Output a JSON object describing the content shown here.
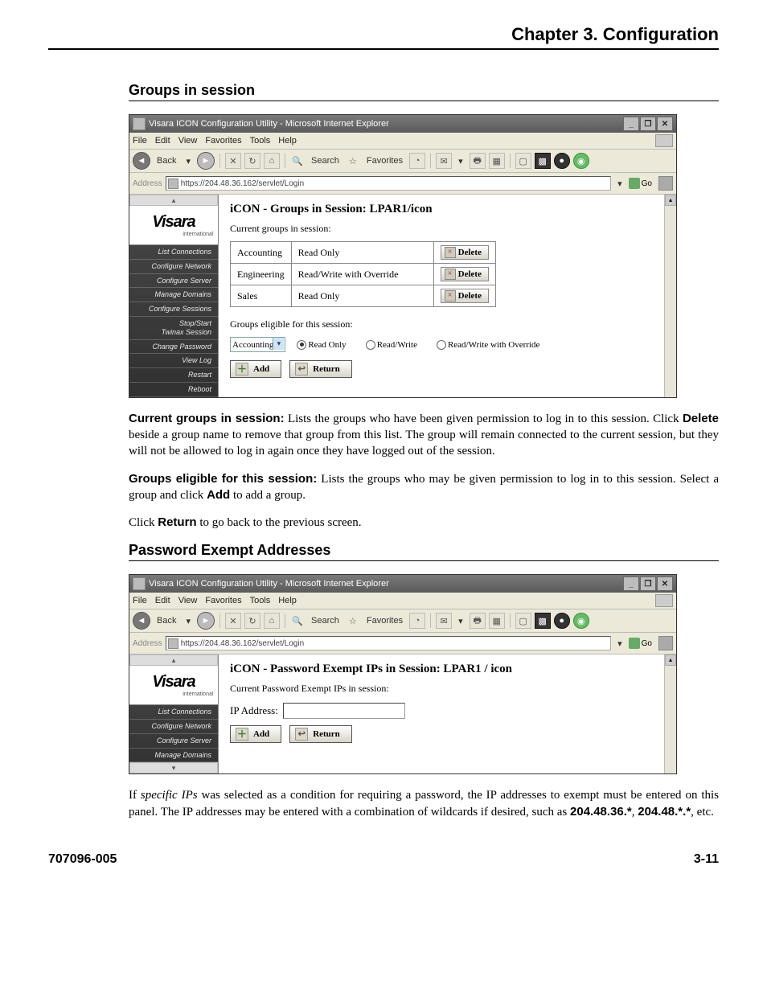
{
  "chapter_title": "Chapter 3.  Configuration",
  "section1": {
    "heading": "Groups in session",
    "para1": {
      "lead": "Current groups in session:",
      "body_a": " Lists the groups who have been given permission to log in to this session. Click ",
      "bold_delete": "Delete",
      "body_b": " beside a group name to remove that group from this list. The group will remain connected to the current session, but they will not be allowed to log in again once they have logged out of the session."
    },
    "para2": {
      "lead": "Groups eligible for this session:",
      "body_a": "  Lists the groups who may be given permission to log in to this session. Select a group and click ",
      "bold_add": "Add",
      "body_b": " to add a group."
    },
    "para3": {
      "prefix": "Click ",
      "bold_return": "Return",
      "suffix": " to go back to the previous screen."
    }
  },
  "screenshot1": {
    "title": "Visara ICON Configuration Utility - Microsoft Internet Explorer",
    "menubar": [
      "File",
      "Edit",
      "View",
      "Favorites",
      "Tools",
      "Help"
    ],
    "toolbar": {
      "back": "Back",
      "search": "Search",
      "favorites": "Favorites"
    },
    "address_label": "Address",
    "address_value": "https://204.48.36.162/servlet/Login",
    "go_label": "Go",
    "logo_main": "Visara",
    "logo_sub": "international",
    "nav_items": [
      "List Connections",
      "Configure Network",
      "Configure Server",
      "Manage Domains",
      "Configure Sessions",
      "Stop/Start\nTwinax Session",
      "Change Password",
      "View Log",
      "Restart",
      "Reboot"
    ],
    "content_title": "iCON - Groups in Session: LPAR1/icon",
    "current_groups_label": "Current groups in session:",
    "groups_table": [
      {
        "name": "Accounting",
        "mode": "Read Only"
      },
      {
        "name": "Engineering",
        "mode": "Read/Write with Override"
      },
      {
        "name": "Sales",
        "mode": "Read Only"
      }
    ],
    "delete_label": "Delete",
    "eligible_label": "Groups eligible for this session:",
    "eligible_select_value": "Accounting",
    "radio_options": [
      "Read Only",
      "Read/Write",
      "Read/Write with Override"
    ],
    "add_label": "Add",
    "return_label": "Return"
  },
  "section2": {
    "heading": "Password Exempt Addresses",
    "para1": {
      "prefix": "If ",
      "italic": "specific IPs",
      "body_a": " was selected as a condition for requiring a password, the IP addresses to exempt must be entered on this panel. The IP addresses may be entered with a combination of wildcards if desired, such as ",
      "ex1": "204.48.36.*",
      "sep": ", ",
      "ex2": "204.48.*.*",
      "suffix": ", etc."
    }
  },
  "screenshot2": {
    "title": "Visara ICON Configuration Utility - Microsoft Internet Explorer",
    "menubar": [
      "File",
      "Edit",
      "View",
      "Favorites",
      "Tools",
      "Help"
    ],
    "toolbar": {
      "back": "Back",
      "search": "Search",
      "favorites": "Favorites"
    },
    "address_label": "Address",
    "address_value": "https://204.48.36.162/servlet/Login",
    "go_label": "Go",
    "logo_main": "Visara",
    "logo_sub": "international",
    "nav_items": [
      "List Connections",
      "Configure Network",
      "Configure Server",
      "Manage Domains"
    ],
    "content_title": "iCON - Password Exempt IPs in Session: LPAR1 / icon",
    "current_label": "Current Password Exempt IPs in session:",
    "ip_label": "IP Address:",
    "add_label": "Add",
    "return_label": "Return"
  },
  "footer": {
    "left": "707096-005",
    "right": "3-11"
  }
}
